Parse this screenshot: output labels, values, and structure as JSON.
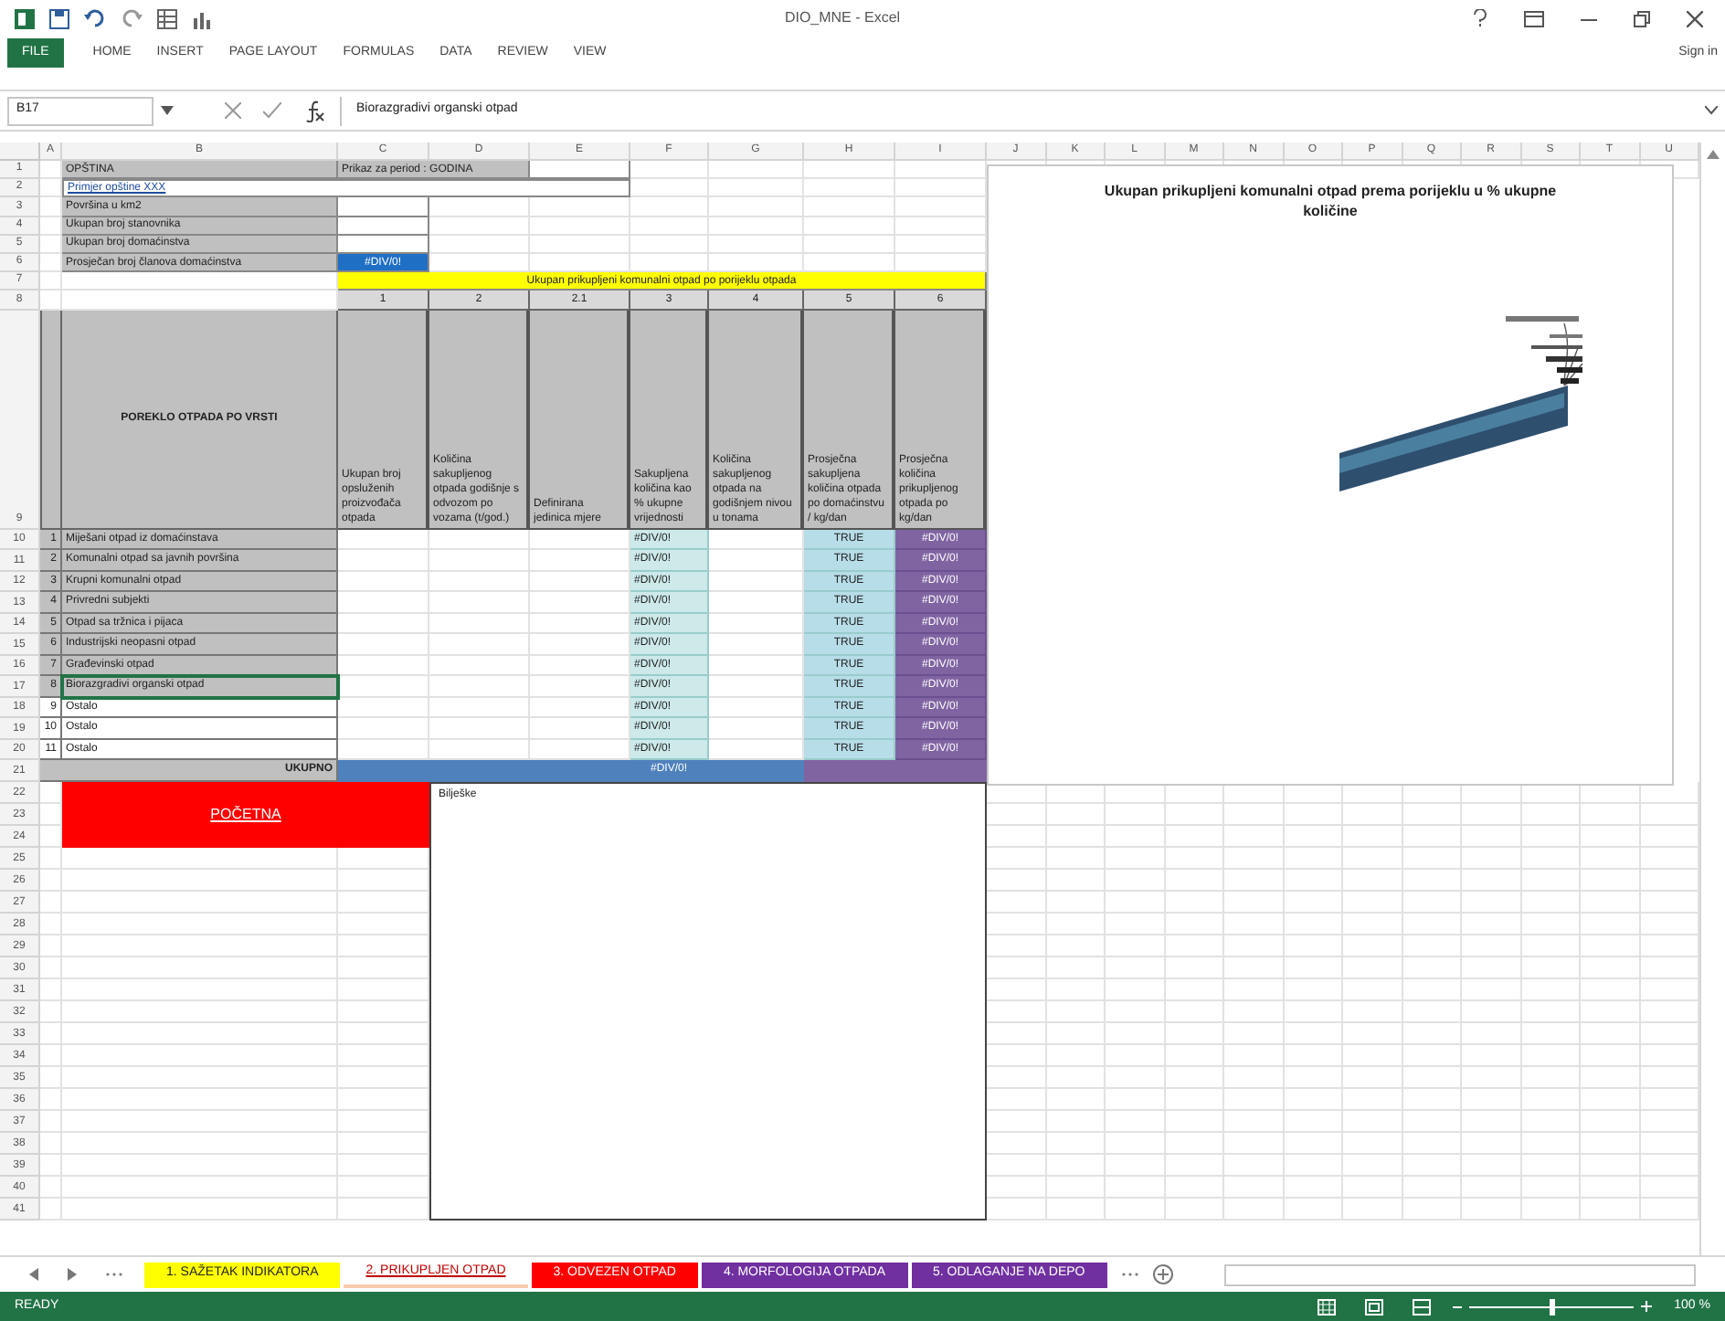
{
  "window": {
    "title": "DIO_MNE - Excel",
    "sign_in": "Sign in"
  },
  "file_tab": "FILE",
  "ribbon_tabs": [
    {
      "label": "HOME",
      "selected": false
    },
    {
      "label": "INSERT",
      "selected": false
    },
    {
      "label": "PAGE LAYOUT",
      "selected": false
    },
    {
      "label": "FORMULAS",
      "selected": false
    },
    {
      "label": "DATA",
      "selected": false
    },
    {
      "label": "REVIEW",
      "selected": false
    },
    {
      "label": "VIEW",
      "selected": false
    }
  ],
  "formula_bar": {
    "name_box": "B17",
    "formula": "Biorazgradivi organski otpad"
  },
  "row_numbers": [
    "1",
    "2",
    "3",
    "4",
    "5",
    "6",
    "7",
    "8",
    "9",
    "10",
    "11",
    "12",
    "13",
    "14",
    "15",
    "16",
    "17",
    "18",
    "19",
    "20",
    "21",
    "22",
    "23",
    "24",
    "25",
    "26",
    "27",
    "28",
    "29",
    "30",
    "31",
    "32",
    "33",
    "34",
    "35",
    "36",
    "37",
    "38",
    "39",
    "40",
    "41"
  ],
  "columns": [
    "A",
    "B",
    "C",
    "D",
    "E",
    "F",
    "G",
    "H",
    "I",
    "J",
    "K",
    "L",
    "M",
    "N",
    "O",
    "P",
    "Q",
    "R",
    "S",
    "T",
    "U"
  ],
  "info": [
    {
      "label": "OPŠTINA",
      "value": "Prikaz za period : GODINA"
    },
    {
      "label": "Primjer opštine XXX"
    },
    {
      "label": "Površina u km2"
    },
    {
      "label": "Ukupan broj stanovnika"
    },
    {
      "label": "Ukupan broj domaćinstva"
    },
    {
      "label": "Prosječan broj članova domaćinstva",
      "value": "#DIV/0!"
    }
  ],
  "section_title": "Ukupan prikupljeni komunalni otpad po porijeklu otpada",
  "column_numbers": [
    "1",
    "2",
    "2.1",
    "3",
    "4",
    "5",
    "6"
  ],
  "table_header": "POREKLO OTPADA PO VRSTI",
  "table_columns": [
    "Ukupan broj opsluženih proizvođača otpada",
    "Količina sakupljenog otpada godišnje s odvozom po vozama (t/god.)",
    "Definirana jedinica mjere",
    "Sakupljena količina kao % ukupne vrijednosti",
    "Količina sakupljenog otpada na godišnjem nivou u tonama",
    "Prosječna sakupljena količina otpada po domaćinstvu / kg/dan",
    "Prosječna količina prikupljenog otpada po kg/dan"
  ],
  "rows": [
    {
      "number": "1",
      "name": "Miješani otpad iz domaćinstava",
      "kind": "category",
      "selected": false,
      "share": "#DIV/0!",
      "per_household": "TRUE",
      "per_day": "#DIV/0!"
    },
    {
      "number": "2",
      "name": "Komunalni otpad sa javnih površina",
      "kind": "category",
      "selected": false,
      "share": "#DIV/0!",
      "per_household": "TRUE",
      "per_day": "#DIV/0!"
    },
    {
      "number": "3",
      "name": "Krupni komunalni otpad",
      "kind": "category",
      "selected": false,
      "share": "#DIV/0!",
      "per_household": "TRUE",
      "per_day": "#DIV/0!"
    },
    {
      "number": "4",
      "name": "Privredni subjekti",
      "kind": "category",
      "selected": false,
      "share": "#DIV/0!",
      "per_household": "TRUE",
      "per_day": "#DIV/0!"
    },
    {
      "number": "5",
      "name": "Otpad sa tržnica i pijaca",
      "kind": "category",
      "selected": false,
      "share": "#DIV/0!",
      "per_household": "TRUE",
      "per_day": "#DIV/0!"
    },
    {
      "number": "6",
      "name": "Industrijski neopasni otpad",
      "kind": "category",
      "selected": false,
      "share": "#DIV/0!",
      "per_household": "TRUE",
      "per_day": "#DIV/0!"
    },
    {
      "number": "7",
      "name": "Građevinski otpad",
      "kind": "category",
      "selected": false,
      "share": "#DIV/0!",
      "per_household": "TRUE",
      "per_day": "#DIV/0!"
    },
    {
      "number": "8",
      "name": "Biorazgradivi organski otpad",
      "kind": "category",
      "selected": true,
      "share": "#DIV/0!",
      "per_household": "TRUE",
      "per_day": "#DIV/0!"
    },
    {
      "number": "9",
      "name": "Ostalo",
      "kind": "other",
      "selected": false,
      "share": "#DIV/0!",
      "per_household": "TRUE",
      "per_day": "#DIV/0!"
    },
    {
      "number": "10",
      "name": "Ostalo",
      "kind": "other",
      "selected": false,
      "share": "#DIV/0!",
      "per_household": "TRUE",
      "per_day": "#DIV/0!"
    },
    {
      "number": "11",
      "name": "Ostalo",
      "kind": "other",
      "selected": false,
      "share": "#DIV/0!",
      "per_household": "TRUE",
      "per_day": "#DIV/0!"
    }
  ],
  "total": {
    "label": "UKUPNO",
    "share": "#DIV/0!"
  },
  "home_button": "POČETNA",
  "notes": {
    "label": "Bilješke"
  },
  "chart": {
    "title": "Ukupan prikupljeni komunalni otpad prema porijeklu u % ukupne količine"
  },
  "sheet_tabs": [
    {
      "label": "1. SAŽETAK INDIKATORA",
      "color": "#ffff00",
      "selected": false
    },
    {
      "label": "2. PRIKUPLJEN OTPAD",
      "color": "#f8cbad",
      "selected": true
    },
    {
      "label": "3. ODVEZEN OTPAD",
      "color": "#ff0000",
      "selected": false
    },
    {
      "label": "4. MORFOLOGIJA OTPADA",
      "color": "#7030a0",
      "selected": false
    },
    {
      "label": "5. ODLAGANJE NA DEPO",
      "color": "#7030a0",
      "selected": false
    }
  ],
  "status": "READY",
  "zoom": {
    "level": 0.5,
    "reading": "100 %"
  }
}
